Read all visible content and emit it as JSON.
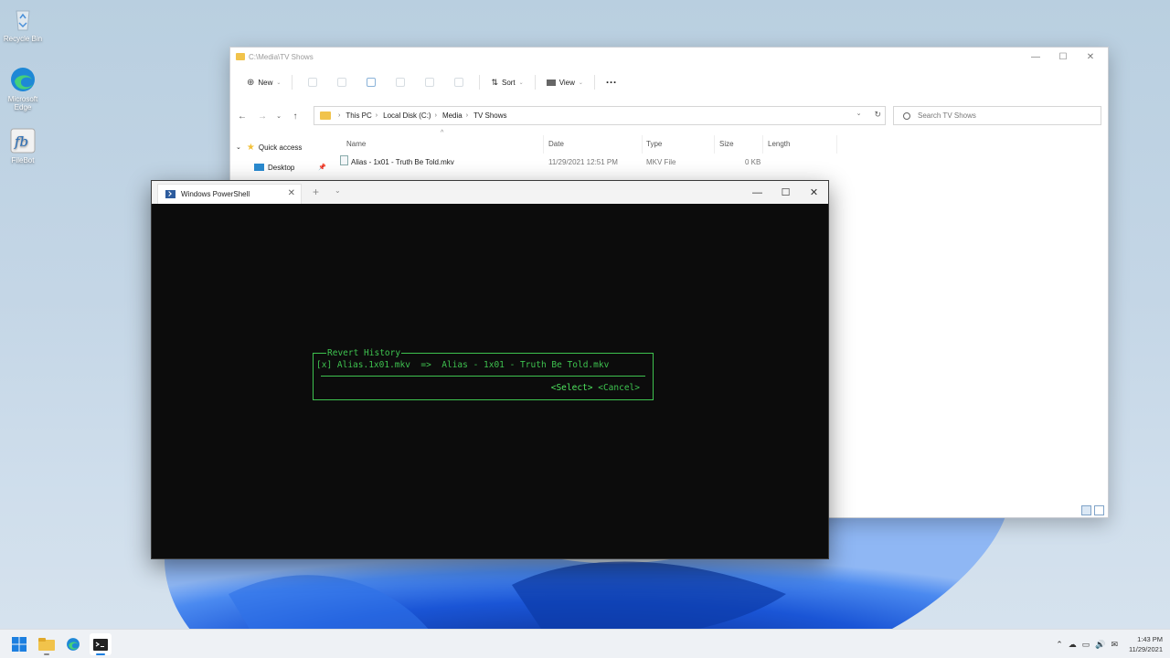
{
  "desktop": {
    "icons": [
      {
        "label": "Recycle Bin"
      },
      {
        "label": "Microsoft Edge"
      },
      {
        "label": "FileBot"
      }
    ]
  },
  "explorer": {
    "title": "C:\\Media\\TV Shows",
    "command_bar": {
      "new_label": "New",
      "sort_label": "Sort",
      "view_label": "View",
      "more_label": "···"
    },
    "address": {
      "crumbs": [
        "This PC",
        "Local Disk (C:)",
        "Media",
        "TV Shows"
      ]
    },
    "search": {
      "placeholder": "Search TV Shows"
    },
    "sidebar": {
      "quick_access": "Quick access",
      "desktop": "Desktop"
    },
    "columns": [
      "Name",
      "Date",
      "Type",
      "Size",
      "Length"
    ],
    "files": [
      {
        "name": "Alias - 1x01 - Truth Be Told.mkv",
        "date": "11/29/2021 12:51 PM",
        "type": "MKV File",
        "size": "0 KB",
        "length": ""
      }
    ]
  },
  "terminal": {
    "tab_title": "Windows PowerShell",
    "dialog": {
      "title": "Revert History",
      "item": "[x] Alias.1x01.mkv  =>  Alias - 1x01 - Truth Be Told.mkv",
      "select_label": "<Select>",
      "cancel_label": "<Cancel>"
    }
  },
  "taskbar": {
    "time": "1:43 PM",
    "date": "11/29/2021"
  },
  "colors": {
    "terminal_green": "#3ec24f",
    "terminal_bg": "#0c0c0c",
    "folder_yellow": "#f1c34b"
  }
}
